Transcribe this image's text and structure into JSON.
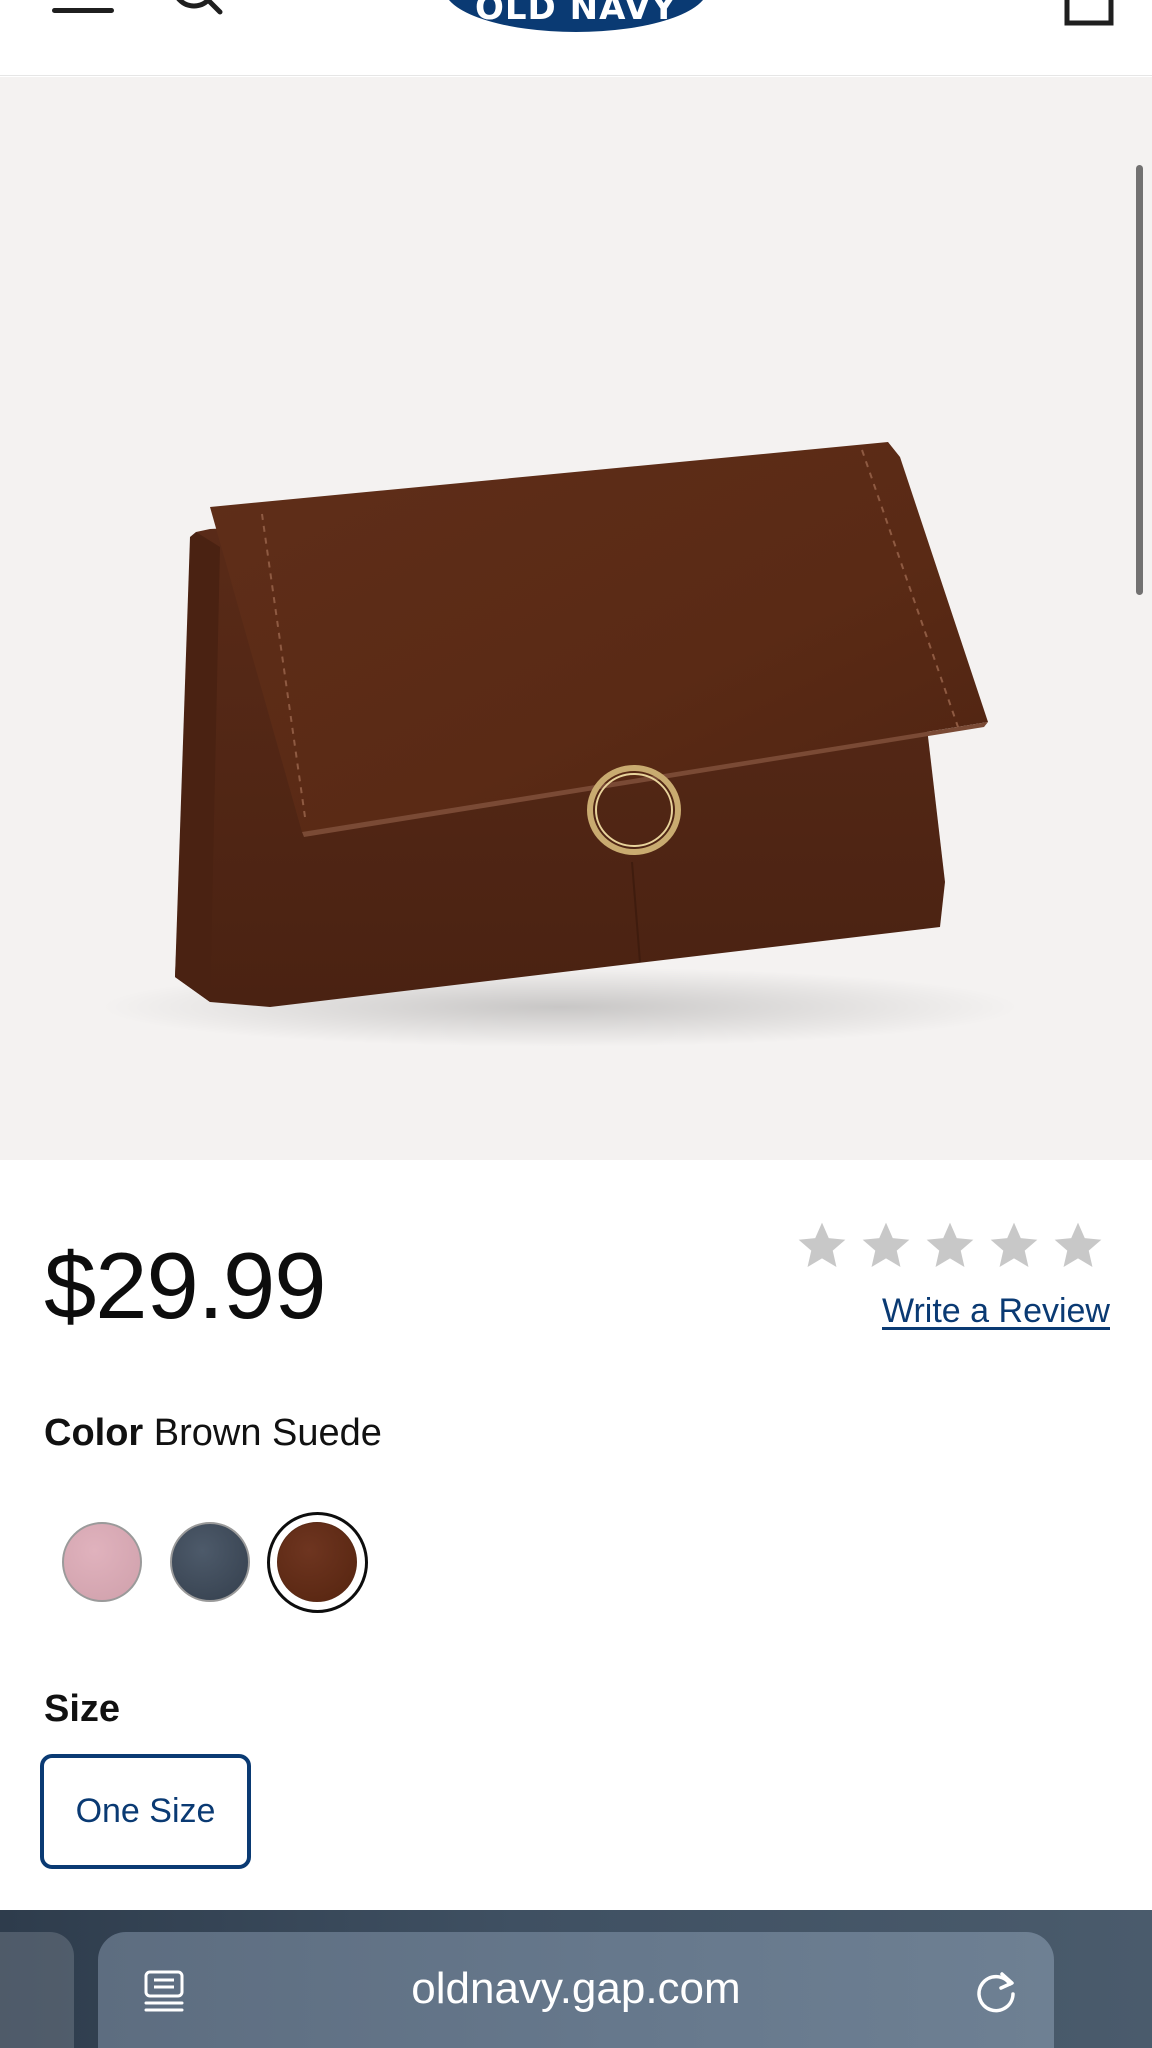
{
  "header": {
    "logo_text": "OLD NAVY",
    "icons": [
      "menu-icon",
      "search-icon",
      "bag-icon"
    ]
  },
  "gallery": {
    "image_count": 4,
    "active_index": 0
  },
  "product": {
    "price": "$29.99",
    "rating_stars": 5,
    "write_review": "Write a Review",
    "color_label": "Color",
    "color_value": "Brown Suede",
    "swatches": [
      {
        "name": "pink",
        "color": "#d9a9b4"
      },
      {
        "name": "navy",
        "color": "#3d4856"
      },
      {
        "name": "brown",
        "color": "#5e2a14",
        "selected": true
      }
    ],
    "size_label": "Size",
    "size_option": "One Size"
  },
  "browser": {
    "url": "oldnavy.gap.com"
  },
  "colors": {
    "brand_navy": "#0a3a73",
    "star_gray": "#c8c8c8",
    "bar_bg": "#3f5062"
  }
}
